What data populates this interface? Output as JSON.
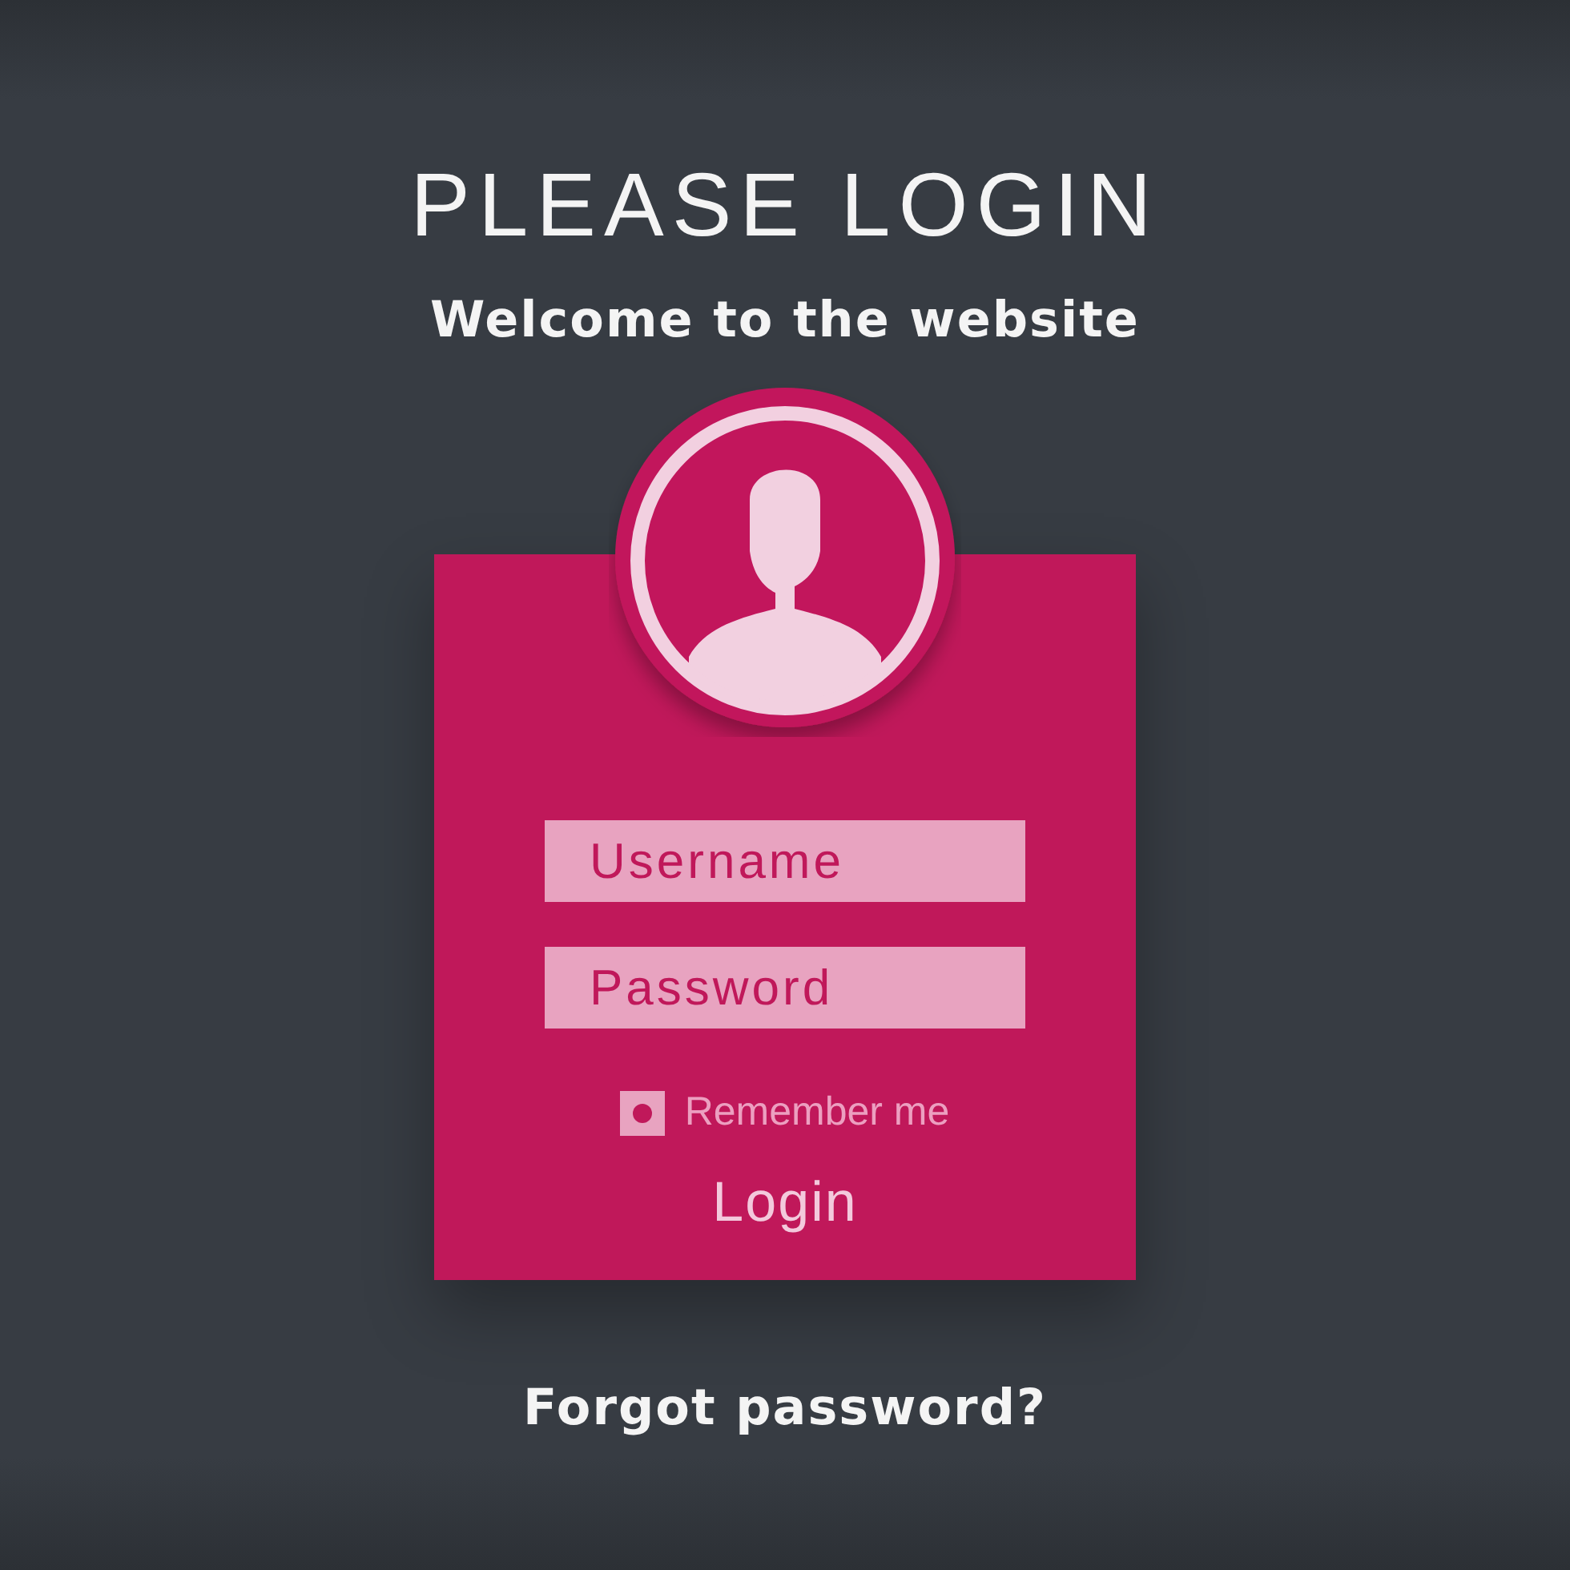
{
  "title": "PLEASE LOGIN",
  "subtitle": "Welcome to the website",
  "form": {
    "fields": [
      {
        "placeholder": "Username"
      },
      {
        "placeholder": "Password"
      }
    ],
    "remember": {
      "label": "Remember me",
      "checked": true
    },
    "submit": "Login"
  },
  "forgot_link": "Forgot password?"
}
